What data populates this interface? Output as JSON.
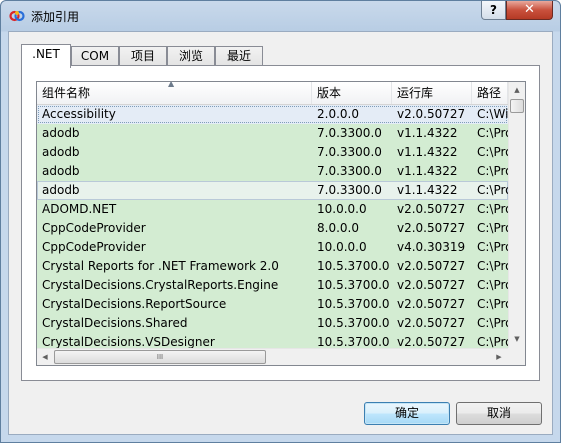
{
  "window": {
    "title": "添加引用",
    "help_label": "?",
    "close_label": "✕"
  },
  "tabs": [
    {
      "label": ".NET",
      "active": true
    },
    {
      "label": "COM",
      "active": false
    },
    {
      "label": "项目",
      "active": false
    },
    {
      "label": "浏览",
      "active": false
    },
    {
      "label": "最近",
      "active": false
    }
  ],
  "columns": [
    "组件名称",
    "版本",
    "运行库",
    "路径"
  ],
  "rows": [
    {
      "name": "Accessibility",
      "version": "2.0.0.0",
      "runtime": "v2.0.50727",
      "path": "C:\\Wi"
    },
    {
      "name": "adodb",
      "version": "7.0.3300.0",
      "runtime": "v1.1.4322",
      "path": "C:\\Pro"
    },
    {
      "name": "adodb",
      "version": "7.0.3300.0",
      "runtime": "v1.1.4322",
      "path": "C:\\Pro"
    },
    {
      "name": "adodb",
      "version": "7.0.3300.0",
      "runtime": "v1.1.4322",
      "path": "C:\\Pro"
    },
    {
      "name": "adodb",
      "version": "7.0.3300.0",
      "runtime": "v1.1.4322",
      "path": "C:\\Pro"
    },
    {
      "name": "ADOMD.NET",
      "version": "10.0.0.0",
      "runtime": "v2.0.50727",
      "path": "C:\\Pro"
    },
    {
      "name": "CppCodeProvider",
      "version": "8.0.0.0",
      "runtime": "v2.0.50727",
      "path": "C:\\Pro"
    },
    {
      "name": "CppCodeProvider",
      "version": "10.0.0.0",
      "runtime": "v4.0.30319",
      "path": "C:\\Pro"
    },
    {
      "name": "Crystal Reports for .NET Framework 2.0",
      "version": "10.5.3700.0",
      "runtime": "v2.0.50727",
      "path": "C:\\Pro"
    },
    {
      "name": "CrystalDecisions.CrystalReports.Engine",
      "version": "10.5.3700.0",
      "runtime": "v2.0.50727",
      "path": "C:\\Pro"
    },
    {
      "name": "CrystalDecisions.ReportSource",
      "version": "10.5.3700.0",
      "runtime": "v2.0.50727",
      "path": "C:\\Pro"
    },
    {
      "name": "CrystalDecisions.Shared",
      "version": "10.5.3700.0",
      "runtime": "v2.0.50727",
      "path": "C:\\Pro"
    },
    {
      "name": "CrystalDecisions.VSDesigner",
      "version": "10.5.3700.0",
      "runtime": "v2.0.50727",
      "path": "C:\\Pro"
    }
  ],
  "scroll": {
    "up": "▲",
    "down": "▼",
    "left": "◀",
    "right": "▶",
    "grip": "III",
    "sort": "▲"
  },
  "buttons": {
    "ok": "确定",
    "cancel": "取消"
  }
}
